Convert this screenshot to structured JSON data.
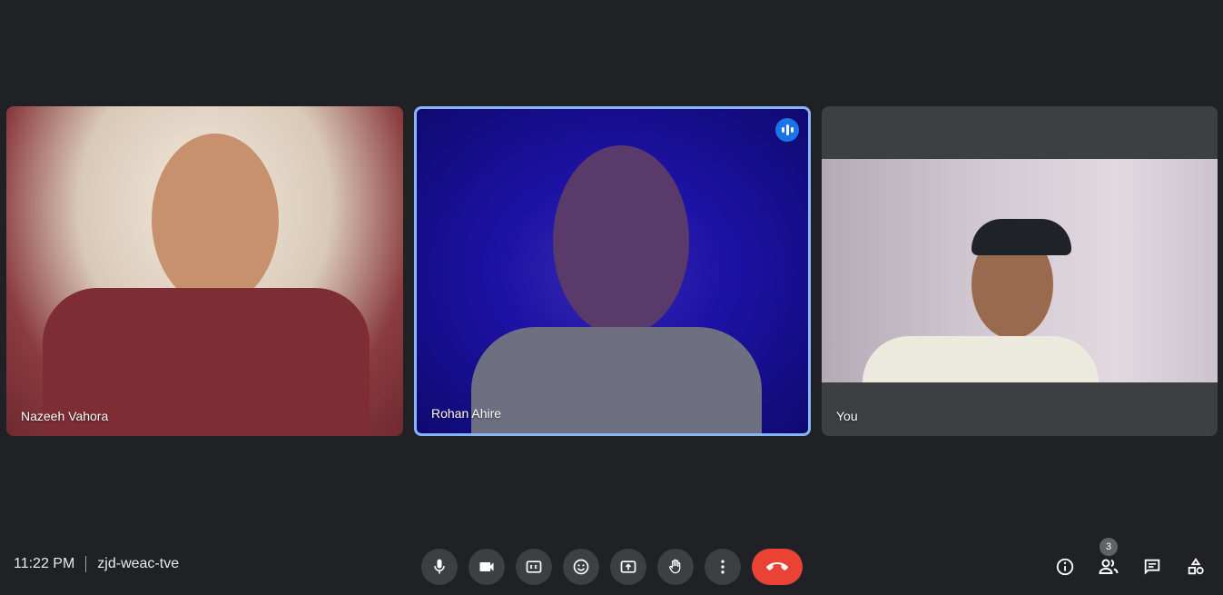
{
  "participants": [
    {
      "name": "Nazeeh Vahora"
    },
    {
      "name": "Rohan Ahire"
    },
    {
      "name": "You"
    }
  ],
  "meeting": {
    "time": "11:22 PM",
    "code": "zjd-weac-tve"
  },
  "people_count": "3",
  "colors": {
    "background": "#202124",
    "active_border": "#8ab4f8",
    "end_call": "#ea4335",
    "button": "#3c4043"
  },
  "controls": [
    "microphone-icon",
    "camera-icon",
    "captions-icon",
    "emoji-icon",
    "present-screen-icon",
    "raise-hand-icon",
    "more-options-icon",
    "end-call-icon"
  ],
  "right_tools": [
    "info-icon",
    "people-icon",
    "chat-icon",
    "activities-icon"
  ]
}
